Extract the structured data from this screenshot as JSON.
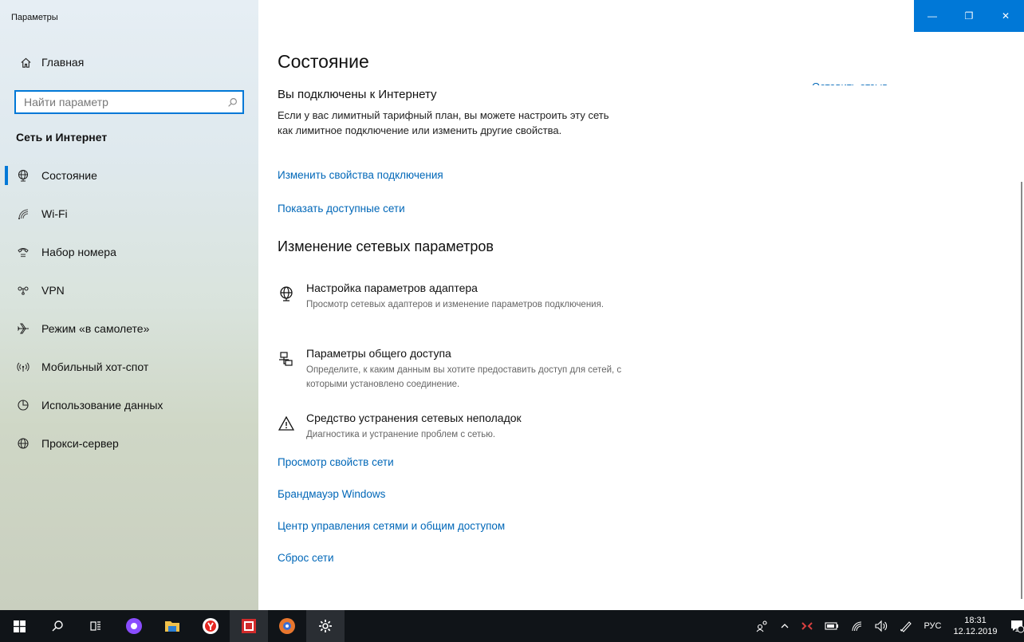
{
  "app": {
    "title": "Параметры"
  },
  "window_controls": {
    "minimize_glyph": "—",
    "maximize_glyph": "❐",
    "close_glyph": "✕"
  },
  "sidebar": {
    "home_label": "Главная",
    "search_placeholder": "Найти параметр",
    "group_title": "Сеть и Интернет",
    "items": [
      {
        "label": "Состояние",
        "icon": "globe-network-icon",
        "active": true
      },
      {
        "label": "Wi-Fi",
        "icon": "wifi-icon",
        "active": false
      },
      {
        "label": "Набор номера",
        "icon": "dial-up-icon",
        "active": false
      },
      {
        "label": "VPN",
        "icon": "vpn-icon",
        "active": false
      },
      {
        "label": "Режим «в самолете»",
        "icon": "airplane-icon",
        "active": false
      },
      {
        "label": "Мобильный хот-спот",
        "icon": "hotspot-icon",
        "active": false
      },
      {
        "label": "Использование данных",
        "icon": "data-usage-icon",
        "active": false
      },
      {
        "label": "Прокси-сервер",
        "icon": "proxy-globe-icon",
        "active": false
      }
    ]
  },
  "main": {
    "title": "Состояние",
    "feedback_link": "Оставить отзыв",
    "status_heading": "Вы подключены к Интернету",
    "status_description": "Если у вас лимитный тарифный план, вы можете настроить эту сеть как лимитное подключение или изменить другие свойства.",
    "link_change_properties": "Изменить свойства подключения",
    "link_show_networks": "Показать доступные сети",
    "section_title": "Изменение сетевых параметров",
    "options": [
      {
        "icon": "adapter-globe-icon",
        "title": "Настройка параметров адаптера",
        "description": "Просмотр сетевых адаптеров и изменение параметров подключения."
      },
      {
        "icon": "sharing-icon",
        "title": "Параметры общего доступа",
        "description": "Определите, к каким данным вы хотите предоставить доступ для сетей, с которыми установлено соединение."
      },
      {
        "icon": "warning-triangle-icon",
        "title": "Средство устранения сетевых неполадок",
        "description": "Диагностика и устранение проблем с сетью."
      }
    ],
    "links": [
      "Просмотр свойств сети",
      "Брандмауэр Windows",
      "Центр управления сетями и общим доступом",
      "Сброс сети"
    ]
  },
  "taskbar": {
    "language": "РУС",
    "time": "18:31",
    "date": "12.12.2019",
    "notification_count": "1",
    "apps": [
      "start-icon",
      "search-icon",
      "task-view-icon",
      "alice-icon",
      "file-explorer-icon",
      "yandex-browser-icon",
      "app-red-icon",
      "app-eye-icon",
      "settings-gear-icon"
    ]
  },
  "colors": {
    "accent": "#0078d7",
    "link": "#0067b8",
    "taskbar": "#101418"
  }
}
